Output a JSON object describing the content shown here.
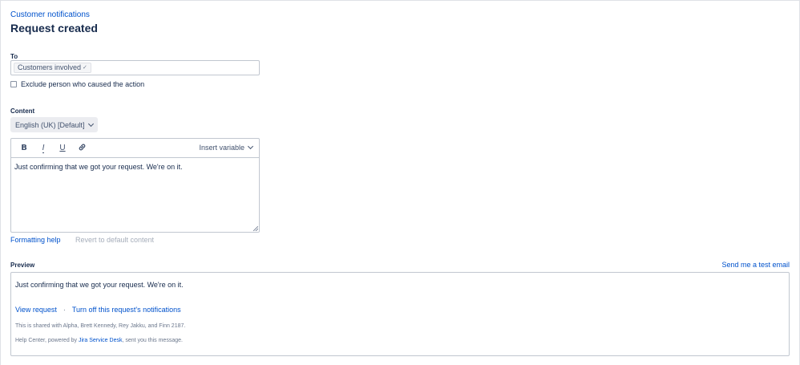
{
  "breadcrumb": "Customer notifications",
  "page_title": "Request created",
  "to": {
    "label": "To",
    "tag": "Customers involved",
    "tag_remove_icon": "close-icon"
  },
  "exclude_checkbox": {
    "label": "Exclude person who caused the action",
    "checked": false
  },
  "content": {
    "label": "Content",
    "language": "English (UK) [Default]"
  },
  "editor": {
    "toolbar": {
      "bold": "B",
      "italic": "I",
      "underline": "U",
      "link_icon": "link-icon",
      "insert_variable": "Insert variable"
    },
    "text": "Just confirming that we got your request. We're on it."
  },
  "actions": {
    "formatting_help": "Formatting help",
    "revert": "Revert to default content"
  },
  "preview": {
    "label": "Preview",
    "send_test": "Send me a test email",
    "text": "Just confirming that we got your request. We're on it.",
    "view_request": "View request",
    "separator": "·",
    "turn_off": "Turn off this request's notifications",
    "shared_with": "This is shared with Alpha, Brett Kennedy, Rey Jakku, and Finn 2187.",
    "footer_prefix": "Help Center, powered by ",
    "footer_link": "Jira Service Desk",
    "footer_suffix": ", sent you this message."
  },
  "colors": {
    "link": "#0052cc",
    "text": "#172b4d",
    "border": "#c1c7d0",
    "muted": "#6b778c"
  }
}
